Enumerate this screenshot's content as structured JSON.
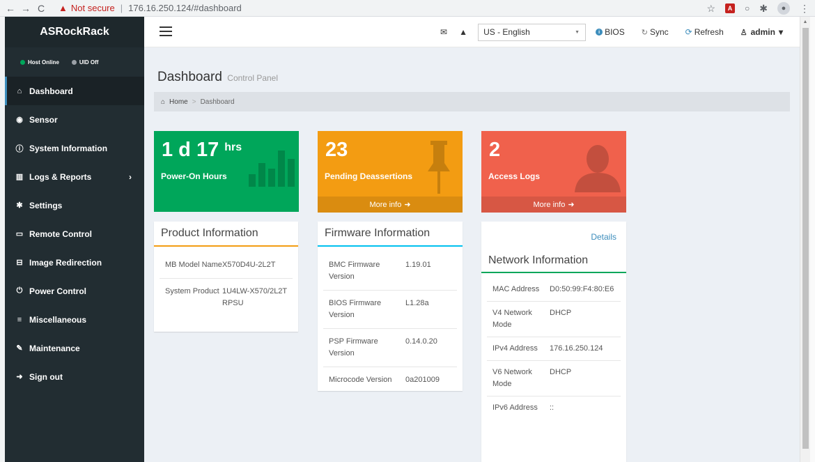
{
  "browser": {
    "back_icon": "←",
    "forward_icon": "→",
    "reload_icon": "C",
    "warning_icon": "▲",
    "not_secure": "Not secure",
    "separator": "|",
    "url": "176.16.250.124/#dashboard",
    "star_icon": "☆",
    "extension_icon": "✱",
    "menu_icon": "⋮"
  },
  "sidebar": {
    "brand": "ASRockRack",
    "status": {
      "host": "Host Online",
      "uid": "UID Off"
    },
    "items": [
      {
        "icon": "⌂",
        "label": "Dashboard"
      },
      {
        "icon": "◉",
        "label": "Sensor"
      },
      {
        "icon": "ⓘ",
        "label": "System Information"
      },
      {
        "icon": "▥",
        "label": "Logs & Reports",
        "arrow": "›"
      },
      {
        "icon": "✱",
        "label": "Settings"
      },
      {
        "icon": "▭",
        "label": "Remote Control"
      },
      {
        "icon": "⊟",
        "label": "Image Redirection"
      },
      {
        "icon": "⏻",
        "label": "Power Control"
      },
      {
        "icon": "≡",
        "label": "Miscellaneous"
      },
      {
        "icon": "✎",
        "label": "Maintenance"
      },
      {
        "icon": "➜",
        "label": "Sign out"
      }
    ]
  },
  "topbar": {
    "mail_icon": "✉",
    "warning_icon": "▲",
    "language": "US - English",
    "language_caret": "▼",
    "bios_label": "BIOS",
    "bios_icon": "i",
    "sync_label": "Sync",
    "sync_icon": "↻",
    "refresh_label": "Refresh",
    "refresh_icon": "⟳",
    "user_icon": "👤",
    "user": "admin",
    "user_caret": "▾"
  },
  "header": {
    "title": "Dashboard",
    "subtitle": "Control Panel"
  },
  "breadcrumb": {
    "home_icon": "⌂",
    "home": "Home",
    "sep": ">",
    "current": "Dashboard"
  },
  "tiles": {
    "power": {
      "value": "1 d 17",
      "unit": "hrs",
      "label": "Power-On Hours"
    },
    "deassert": {
      "value": "23",
      "label": "Pending Deassertions",
      "more": "More info",
      "more_icon": "➜"
    },
    "access": {
      "value": "2",
      "label": "Access Logs",
      "more": "More info",
      "more_icon": "➜"
    }
  },
  "product": {
    "title": "Product Information",
    "rows": [
      {
        "k": "MB Model Name",
        "v": "X570D4U-2L2T"
      },
      {
        "k": "System Product",
        "v": "1U4LW-X570/2L2T RPSU"
      }
    ]
  },
  "firmware": {
    "title": "Firmware Information",
    "rows": [
      {
        "k": "BMC Firmware Version",
        "v": "1.19.01"
      },
      {
        "k": "BIOS Firmware Version",
        "v": "L1.28a"
      },
      {
        "k": "PSP Firmware Version",
        "v": "0.14.0.20"
      },
      {
        "k": "Microcode Version",
        "v": "0a201009"
      }
    ]
  },
  "network": {
    "details": "Details",
    "title": "Network Information",
    "rows": [
      {
        "k": "MAC Address",
        "v": "D0:50:99:F4:80:E6"
      },
      {
        "k": "V4 Network Mode",
        "v": "DHCP"
      },
      {
        "k": "IPv4 Address",
        "v": "176.16.250.124"
      },
      {
        "k": "V6 Network Mode",
        "v": "DHCP"
      },
      {
        "k": "IPv6 Address",
        "v": "::"
      }
    ]
  }
}
